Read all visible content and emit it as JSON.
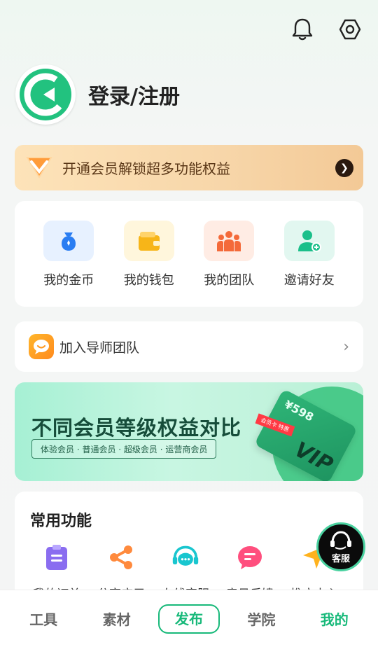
{
  "topbar": {
    "icons": [
      "bell-icon",
      "settings-icon"
    ]
  },
  "profile": {
    "login_label": "登录/注册"
  },
  "vip_bar": {
    "text": "开通会员解锁超多功能权益",
    "arrow": "❯"
  },
  "assets": {
    "items": [
      {
        "label": "我的金币",
        "icon": "coin-bag-icon"
      },
      {
        "label": "我的钱包",
        "icon": "wallet-icon"
      },
      {
        "label": "我的团队",
        "icon": "team-icon"
      },
      {
        "label": "邀请好友",
        "icon": "invite-friend-icon"
      }
    ]
  },
  "mentor": {
    "label": "加入导师团队",
    "chevron": "›"
  },
  "banner": {
    "title": "不同会员等级权益对比",
    "subtitle": "体验会员 · 普通会员 · 超级会员 · 运营商会员",
    "price": "¥598",
    "tag": "会员卡 特惠",
    "vip": "VIP"
  },
  "common": {
    "title": "常用功能",
    "items": [
      {
        "label": "我的订单",
        "icon": "order-icon"
      },
      {
        "label": "分享应用",
        "icon": "share-icon"
      },
      {
        "label": "在线客服",
        "icon": "headset-chat-icon"
      },
      {
        "label": "意见反馈",
        "icon": "feedback-icon"
      },
      {
        "label": "推广中心",
        "icon": "promote-icon"
      }
    ]
  },
  "service_button": {
    "label": "客服"
  },
  "tabbar": {
    "tabs": [
      {
        "label": "工具"
      },
      {
        "label": "素材"
      },
      {
        "label": "发布"
      },
      {
        "label": "学院"
      },
      {
        "label": "我的"
      }
    ],
    "active": "我的"
  },
  "colors": {
    "accent": "#18b97a",
    "vip_gold": "#f7d6a9"
  }
}
